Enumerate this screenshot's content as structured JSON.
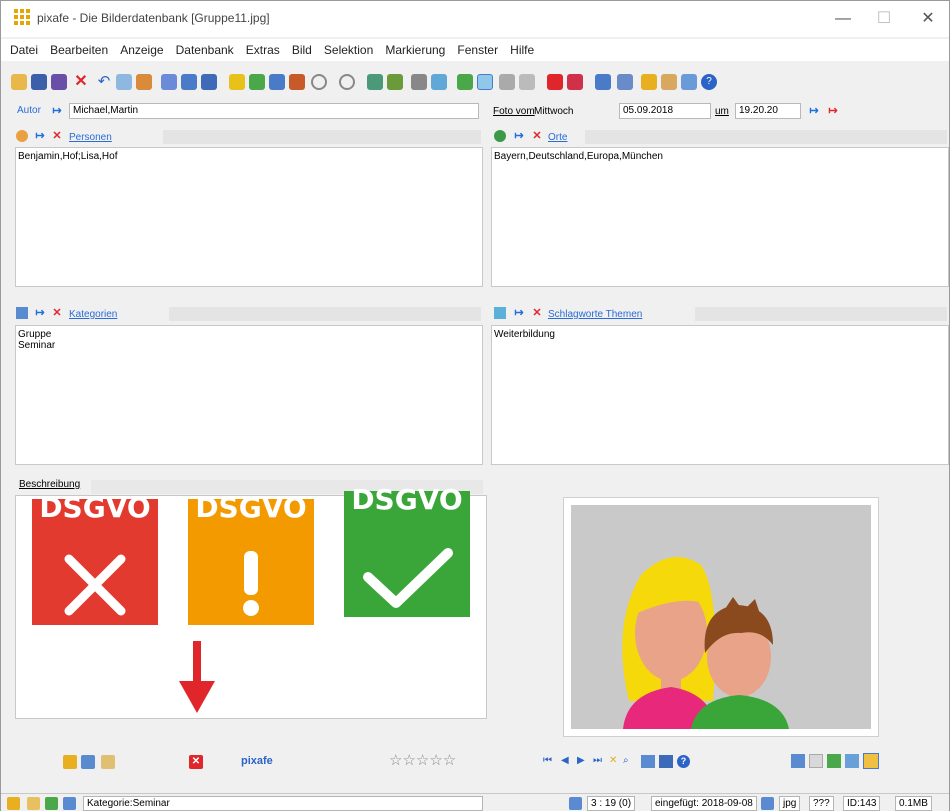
{
  "window": {
    "title": "pixafe - Die Bilderdatenbank  [Gruppe11.jpg]",
    "min_glyph": "—",
    "max_glyph": "☐",
    "close_glyph": "✕"
  },
  "menu": [
    "Datei",
    "Bearbeiten",
    "Anzeige",
    "Datenbank",
    "Extras",
    "Bild",
    "Selektion",
    "Markierung",
    "Fenster",
    "Hilfe"
  ],
  "author": {
    "label": "Autor",
    "value": "Michael,Martin"
  },
  "photo_date": {
    "label": "Foto vom",
    "weekday": "Mittwoch",
    "date": "05.09.2018",
    "at_label": "um",
    "time": "19.20.20"
  },
  "persons": {
    "label": "Personen",
    "values": [
      "Benjamin,Hof;Lisa,Hof"
    ]
  },
  "places": {
    "label": "Orte",
    "values": [
      "Bayern,Deutschland,Europa,München"
    ]
  },
  "categories": {
    "label": "Kategorien",
    "values": [
      "Gruppe",
      "Seminar"
    ]
  },
  "keywords": {
    "label": "Schlagworte Themen",
    "values": [
      "Weiterbildung"
    ]
  },
  "description": {
    "label": "Beschreibung",
    "stamps": [
      {
        "text": "DSGVO",
        "color": "#e23a2f",
        "symbol": "cross"
      },
      {
        "text": "DSGVO",
        "color": "#f29a00",
        "symbol": "exclamation"
      },
      {
        "text": "DSGVO",
        "color": "#3aa63a",
        "symbol": "check"
      }
    ]
  },
  "bottom_bar": {
    "brand": "pixafe",
    "stars": "☆☆☆☆☆"
  },
  "statusbar": {
    "category": "Kategorie:Seminar",
    "position": "3 : 19 (0)",
    "inserted": "eingefügt: 2018-09-08",
    "ext": "jpg",
    "unknown": "???",
    "id": "ID:143",
    "size": "0.1MB"
  },
  "colors": {
    "link_blue": "#2a6bd8",
    "red": "#e0262a",
    "hair_blonde": "#f5d90a",
    "hair_brown": "#8b4a1e",
    "skin": "#e8a389",
    "shirt_pink": "#e8287a",
    "shirt_green": "#3aa63a"
  }
}
